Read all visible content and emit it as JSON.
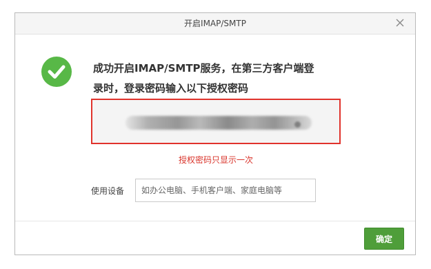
{
  "dialog": {
    "title": "开启IMAP/SMTP",
    "close_icon": "close-icon",
    "success_icon": "check-circle-icon",
    "message_line1": "成功开启IMAP/SMTP服务，在第三方客户端登",
    "message_line2": "录时，登录密码输入以下授权密码",
    "auth_code_hint": "授权密码只显示一次",
    "device_label": "使用设备",
    "device_placeholder": "如办公电脑、手机客户端、家庭电脑等",
    "confirm_label": "确定"
  },
  "colors": {
    "success_green": "#58b847",
    "highlight_red": "#e0322b",
    "button_green": "#4f9e3a",
    "hint_red": "#d9342b"
  }
}
